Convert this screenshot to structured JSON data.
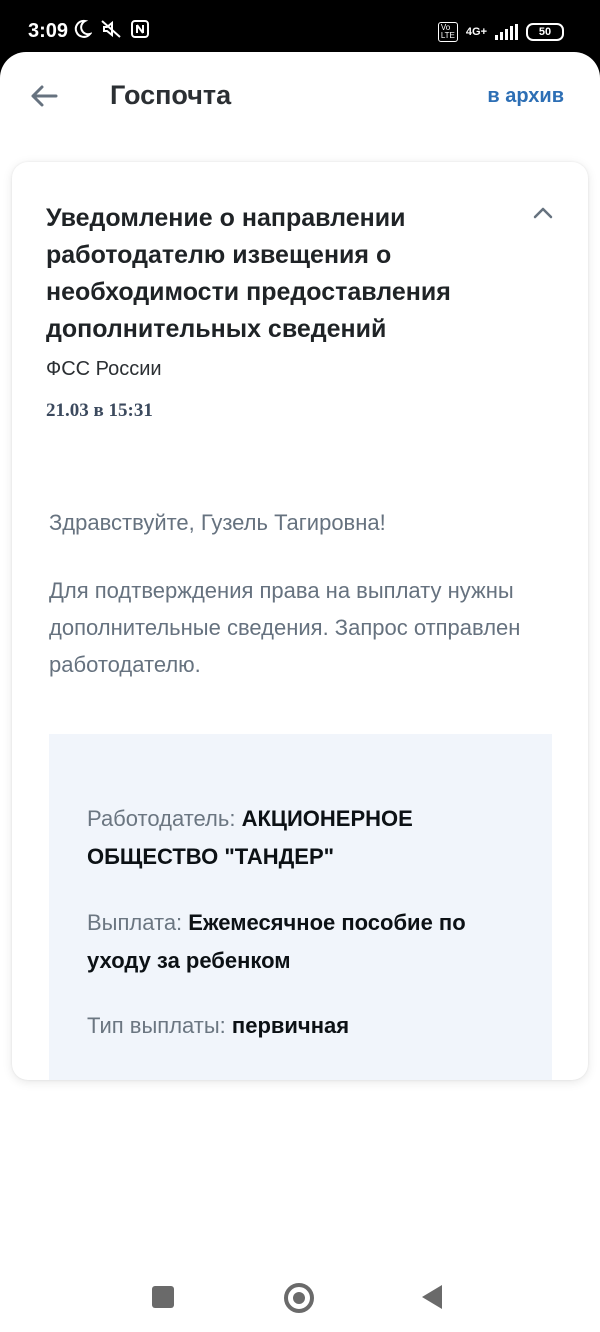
{
  "status_bar": {
    "time": "3:09",
    "battery": "50",
    "network": "4G+",
    "icons": [
      "moon-icon",
      "mute-icon",
      "nfc-icon",
      "volte-icon",
      "signal-icon",
      "battery-icon"
    ]
  },
  "header": {
    "title": "Госпочта",
    "archive_label": "в архив"
  },
  "message": {
    "title": "Уведомление о направлении работодателю извещения о необходимости предоставления дополнительных сведений",
    "sender": "ФСС России",
    "datetime": "21.03 в 15:31",
    "greeting": "Здравствуйте, Гузель Тагировна!",
    "body": "Для подтверждения права на выплату нужны дополнительные сведения. Запрос отправлен работодателю.",
    "details": [
      {
        "label": "Работодатель:",
        "value": "АКЦИОНЕРНОЕ ОБЩЕСТВО \"ТАНДЕР\""
      },
      {
        "label": "Выплата:",
        "value": "Ежемесячное пособие по уходу за ребенком"
      },
      {
        "label": "Тип выплаты:",
        "value": "первичная"
      }
    ]
  },
  "colors": {
    "accent": "#2d6fb5",
    "info_bg": "#f1f5fb",
    "muted_text": "#66727f"
  }
}
